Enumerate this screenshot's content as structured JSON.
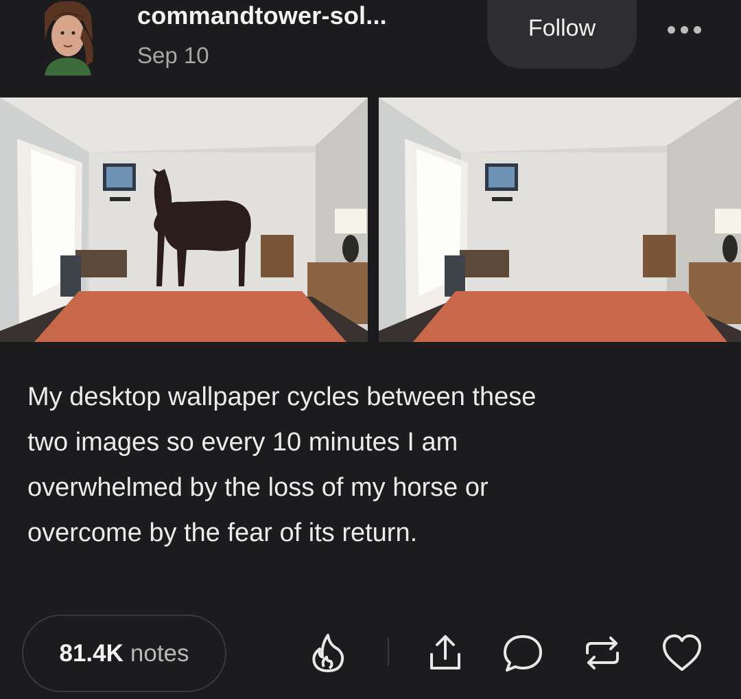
{
  "post": {
    "username": "commandtower-sol...",
    "date": "Sep 10",
    "follow_label": "Follow",
    "more_icon": "more-dots-icon",
    "caption": "My desktop wallpaper cycles between these\ntwo images so every 10 minutes I am\noverwhelmed by the loss of my horse or\novercome by the fear of its return.",
    "images": [
      {
        "name": "hotel-room-with-horse"
      },
      {
        "name": "hotel-room-without-horse"
      }
    ]
  },
  "footer": {
    "notes_count": "81.4K",
    "notes_label": "notes",
    "actions": [
      "flame-icon",
      "share-icon",
      "comment-icon",
      "reblog-icon",
      "heart-icon"
    ]
  },
  "colors": {
    "background": "#1c1c1e",
    "follow_button": "#2e2e31",
    "bedspread": "#c8684a"
  }
}
